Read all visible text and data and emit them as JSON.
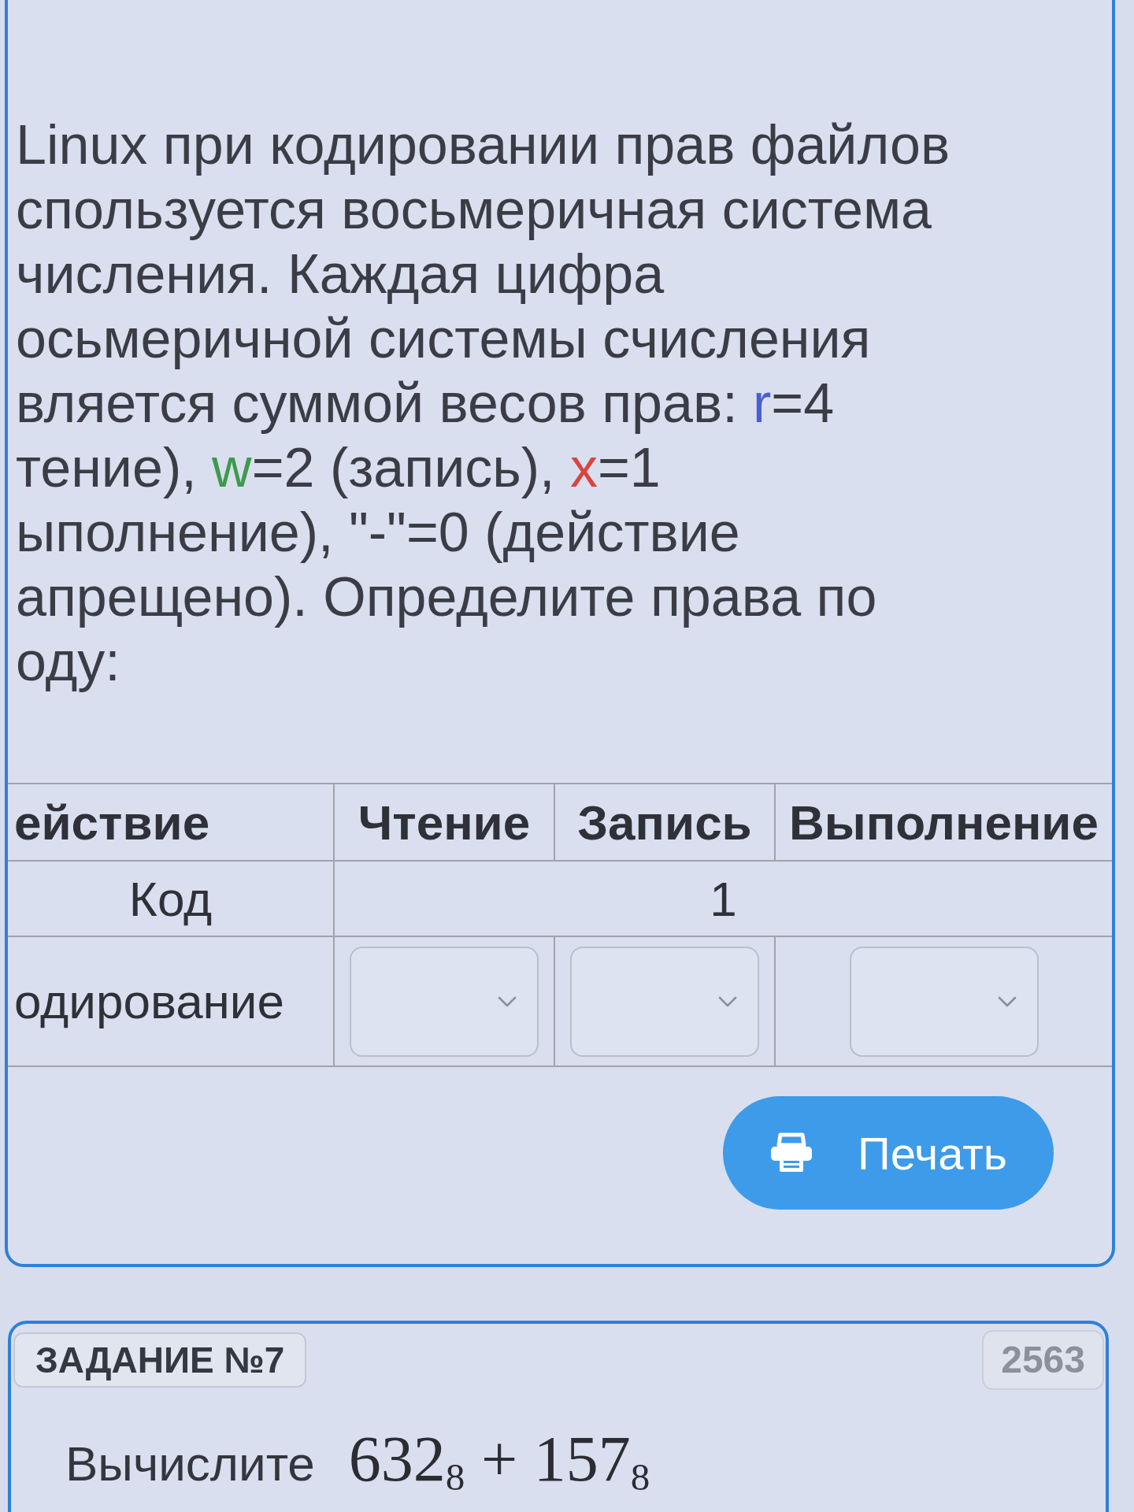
{
  "task": {
    "lines": [
      [
        {
          "text": "Linux при кодировании прав файлов"
        }
      ],
      [
        {
          "text": "спользуется восьмеричная система"
        }
      ],
      [
        {
          "text": "числения. Каждая цифра"
        }
      ],
      [
        {
          "text": "осьмеричной системы счисления"
        }
      ],
      [
        {
          "text": "вляется суммой весов прав: "
        },
        {
          "text": "r",
          "color": "#4a5fd4"
        },
        {
          "text": "=4"
        }
      ],
      [
        {
          "text": "тение), "
        },
        {
          "text": "w",
          "color": "#3e9a4c"
        },
        {
          "text": "=2 (запись), "
        },
        {
          "text": "x",
          "color": "#d8453f"
        },
        {
          "text": "=1"
        }
      ],
      [
        {
          "text": "ыполнение), \"-\"=0 (действие"
        }
      ],
      [
        {
          "text": "апрещено). Определите права по"
        }
      ],
      [
        {
          "text": "оду:"
        }
      ]
    ]
  },
  "table": {
    "columns": [
      "ействие",
      "Чтение",
      "Запись",
      "Выполнение"
    ],
    "rows": [
      {
        "kind": "merged",
        "label": "Код",
        "value": "1"
      },
      {
        "kind": "dropdowns",
        "label": "одирование",
        "cells": [
          {
            "expanded": false
          },
          {
            "expanded": false
          },
          {
            "expanded": false
          }
        ]
      }
    ]
  },
  "print_button": {
    "label": "Печать"
  },
  "next_task": {
    "title": "ЗАДАНИЕ №7",
    "number": "2563",
    "prompt": "Вычислите",
    "formula": "632$_{8}$ + 157$_{8}$"
  }
}
